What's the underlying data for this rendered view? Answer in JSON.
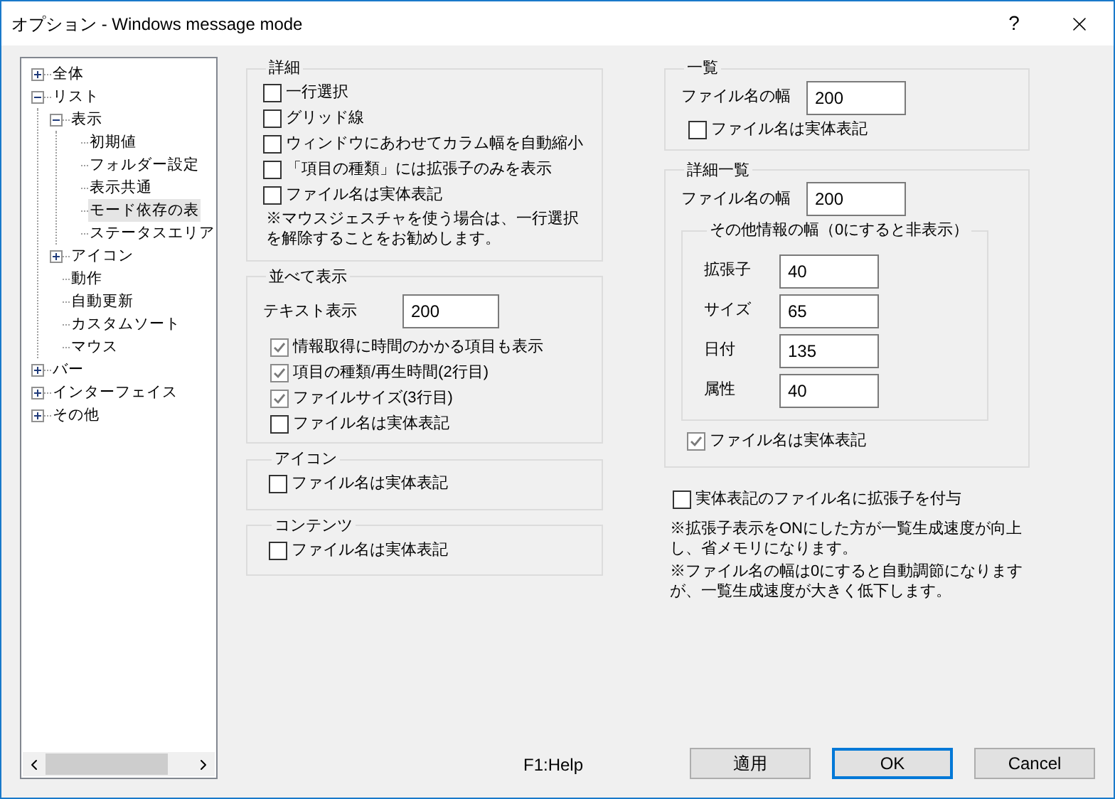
{
  "window": {
    "title": "オプション - Windows message mode",
    "help_button": "?"
  },
  "tree": [
    {
      "label": "全体",
      "expanded": false,
      "selected": false
    },
    {
      "label": "リスト",
      "expanded": true,
      "selected": false,
      "children": [
        {
          "label": "表示",
          "expanded": true,
          "selected": false,
          "children": [
            {
              "label": "初期値",
              "selected": false
            },
            {
              "label": "フォルダー設定",
              "selected": false
            },
            {
              "label": "表示共通",
              "selected": false
            },
            {
              "label": "モード依存の表",
              "selected": true
            },
            {
              "label": "ステータスエリア",
              "selected": false
            }
          ]
        },
        {
          "label": "アイコン",
          "expanded": false,
          "selected": false
        },
        {
          "label": "動作",
          "selected": false
        },
        {
          "label": "自動更新",
          "selected": false
        },
        {
          "label": "カスタムソート",
          "selected": false
        },
        {
          "label": "マウス",
          "selected": false
        }
      ]
    },
    {
      "label": "バー",
      "expanded": false,
      "selected": false
    },
    {
      "label": "インターフェイス",
      "expanded": false,
      "selected": false
    },
    {
      "label": "その他",
      "expanded": false,
      "selected": false
    }
  ],
  "details": {
    "title": "詳細",
    "options": [
      {
        "label": "一行選択",
        "checked": false
      },
      {
        "label": "グリッド線",
        "checked": false
      },
      {
        "label": "ウィンドウにあわせてカラム幅を自動縮小",
        "checked": false
      },
      {
        "label": "「項目の種類」には拡張子のみを表示",
        "checked": false
      },
      {
        "label": "ファイル名は実体表記",
        "checked": false
      }
    ],
    "note": "※マウスジェスチャを使う場合は、一行選択を解除することをお勧めします。"
  },
  "tile": {
    "title": "並べて表示",
    "field": {
      "label": "テキスト表示",
      "value": "200"
    },
    "options": [
      {
        "label": "情報取得に時間のかかる項目も表示",
        "checked": true
      },
      {
        "label": "項目の種類/再生時間(2行目)",
        "checked": true
      },
      {
        "label": "ファイルサイズ(3行目)",
        "checked": true
      },
      {
        "label": "ファイル名は実体表記",
        "checked": false
      }
    ]
  },
  "icon": {
    "title": "アイコン",
    "options": [
      {
        "label": "ファイル名は実体表記",
        "checked": false
      }
    ]
  },
  "contents": {
    "title": "コンテンツ",
    "options": [
      {
        "label": "ファイル名は実体表記",
        "checked": false
      }
    ]
  },
  "list": {
    "title": "一覧",
    "field": {
      "label": "ファイル名の幅",
      "value": "200"
    },
    "options": [
      {
        "label": "ファイル名は実体表記",
        "checked": false
      }
    ]
  },
  "detail_list": {
    "title": "詳細一覧",
    "field": {
      "label": "ファイル名の幅",
      "value": "200"
    },
    "other_widths": {
      "title": "その他情報の幅（0にすると非表示）",
      "fields": [
        {
          "label": "拡張子",
          "value": "40"
        },
        {
          "label": "サイズ",
          "value": "65"
        },
        {
          "label": "日付",
          "value": "135"
        },
        {
          "label": "属性",
          "value": "40"
        }
      ]
    },
    "options": [
      {
        "label": "ファイル名は実体表記",
        "checked": true
      }
    ]
  },
  "add_extension": {
    "label": "実体表記のファイル名に拡張子を付与",
    "checked": false
  },
  "notes": [
    "※拡張子表示をONにした方が一覧生成速度が向上し、省メモリになります。",
    "※ファイル名の幅は0にすると自動調節になりますが、一覧生成速度が大きく低下します。"
  ],
  "footer": {
    "help": "F1:Help",
    "buttons": [
      {
        "label": "適用",
        "default": false
      },
      {
        "label": "OK",
        "default": true
      },
      {
        "label": "Cancel",
        "default": false
      }
    ]
  }
}
